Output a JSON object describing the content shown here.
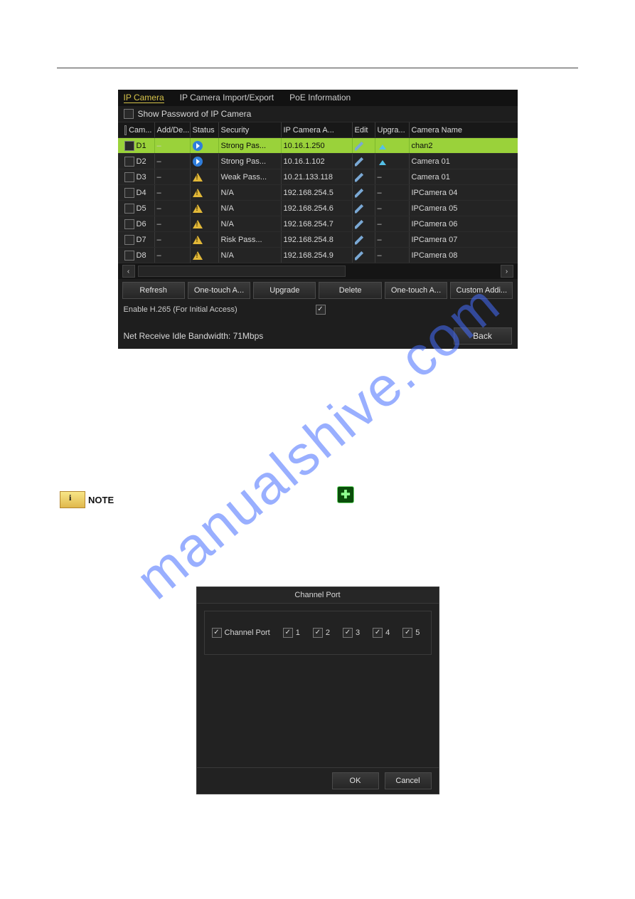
{
  "watermark": "manualshive.com",
  "ss1": {
    "tabs": [
      "IP Camera",
      "IP Camera Import/Export",
      "PoE Information"
    ],
    "activeTabIndex": 0,
    "showPasswordLabel": "Show Password of IP Camera",
    "columns": [
      "Cam...",
      "Add/De...",
      "Status",
      "Security",
      "IP Camera A...",
      "Edit",
      "Upgra...",
      "Camera Name"
    ],
    "rows": [
      {
        "sel": true,
        "cam": "D1",
        "adddel": "-",
        "status": "play",
        "security": "Strong Pas...",
        "ip": "10.16.1.250",
        "edit": "edit",
        "upgrade": "up",
        "name": "chan2"
      },
      {
        "sel": false,
        "cam": "D2",
        "adddel": "-",
        "status": "play",
        "security": "Strong Pas...",
        "ip": "10.16.1.102",
        "edit": "edit",
        "upgrade": "up",
        "name": "Camera 01"
      },
      {
        "sel": false,
        "cam": "D3",
        "adddel": "-",
        "status": "warn",
        "security": "Weak Pass...",
        "ip": "10.21.133.118",
        "edit": "edit",
        "upgrade": "-",
        "name": "Camera 01"
      },
      {
        "sel": false,
        "cam": "D4",
        "adddel": "-",
        "status": "warn",
        "security": "N/A",
        "ip": "192.168.254.5",
        "edit": "edit",
        "upgrade": "-",
        "name": "IPCamera 04"
      },
      {
        "sel": false,
        "cam": "D5",
        "adddel": "-",
        "status": "warn",
        "security": "N/A",
        "ip": "192.168.254.6",
        "edit": "edit",
        "upgrade": "-",
        "name": "IPCamera 05"
      },
      {
        "sel": false,
        "cam": "D6",
        "adddel": "-",
        "status": "warn",
        "security": "N/A",
        "ip": "192.168.254.7",
        "edit": "edit",
        "upgrade": "-",
        "name": "IPCamera 06"
      },
      {
        "sel": false,
        "cam": "D7",
        "adddel": "-",
        "status": "warn",
        "security": "Risk Pass...",
        "ip": "192.168.254.8",
        "edit": "edit",
        "upgrade": "-",
        "name": "IPCamera 07"
      },
      {
        "sel": false,
        "cam": "D8",
        "adddel": "-",
        "status": "warn",
        "security": "N/A",
        "ip": "192.168.254.9",
        "edit": "edit",
        "upgrade": "-",
        "name": "IPCamera 08"
      }
    ],
    "selectedRowIndex": 0,
    "buttons": [
      "Refresh",
      "One-touch A...",
      "Upgrade",
      "Delete",
      "One-touch A...",
      "Custom Addi..."
    ],
    "enableLabel": "Enable H.265 (For Initial Access)",
    "enableChecked": true,
    "bandwidth": "Net Receive Idle Bandwidth: 71Mbps",
    "back": "Back"
  },
  "note": {
    "label": "NOTE"
  },
  "ss2": {
    "title": "Channel Port",
    "rowLabel": "Channel Port",
    "options": [
      "1",
      "2",
      "3",
      "4",
      "5"
    ],
    "ok": "OK",
    "cancel": "Cancel"
  }
}
